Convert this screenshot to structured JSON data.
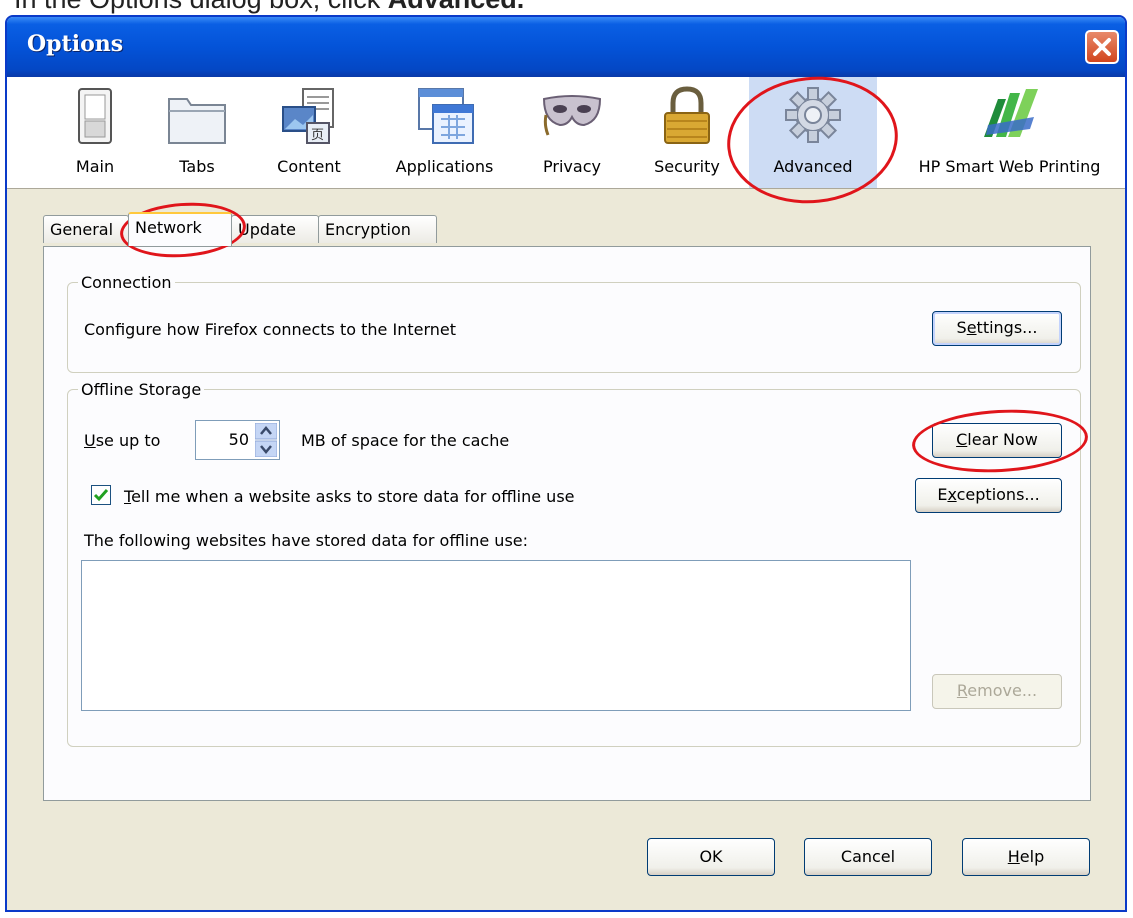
{
  "caption": {
    "prefix": "In the Options dialog box, click ",
    "bold": "Advanced."
  },
  "dialog": {
    "title": "Options"
  },
  "toolbar": {
    "items": [
      {
        "label": "Main"
      },
      {
        "label": "Tabs"
      },
      {
        "label": "Content"
      },
      {
        "label": "Applications"
      },
      {
        "label": "Privacy"
      },
      {
        "label": "Security"
      },
      {
        "label": "Advanced",
        "selected": true
      },
      {
        "label": "HP Smart Web Printing"
      }
    ]
  },
  "tabs": [
    {
      "label": "General"
    },
    {
      "label": "Network",
      "active": true
    },
    {
      "label": "Update"
    },
    {
      "label": "Encryption"
    }
  ],
  "connection": {
    "legend": "Connection",
    "description": "Configure how Firefox connects to the Internet",
    "settings_pre": "S",
    "settings_underlined": "e",
    "settings_post": "ttings..."
  },
  "offline": {
    "legend": "Offline Storage",
    "use_up_to_underlined": "U",
    "use_up_to_rest": "se up to",
    "cache_size": "50",
    "cache_suffix": "MB of space for the cache",
    "clear_underlined": "C",
    "clear_rest": "lear Now",
    "tell_me_underlined": "T",
    "tell_me_rest": "ell me when a website asks to store data for offline use",
    "tell_me_checked": true,
    "exceptions_pre": "E",
    "exceptions_underlined": "x",
    "exceptions_post": "ceptions...",
    "list_label": "The following websites have stored data for offline use:",
    "remove_underlined": "R",
    "remove_rest": "emove..."
  },
  "footer": {
    "ok": "OK",
    "cancel": "Cancel",
    "help_underlined": "H",
    "help_rest": "elp"
  },
  "colors": {
    "annotation_red": "#e0151b",
    "titlebar_blue": "#0453d8",
    "dialog_bg": "#ece9d8"
  }
}
